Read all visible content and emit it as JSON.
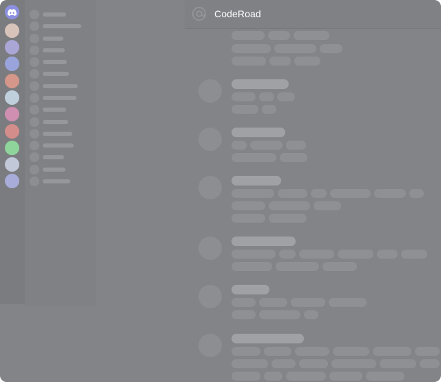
{
  "window": {
    "background": "#838488"
  },
  "header": {
    "title": "CodeRoad",
    "icon": "at-icon"
  },
  "server_rail": {
    "home_icon": "discord-logo-icon",
    "home_color": "#8c90e0",
    "servers": [
      {
        "name": "server-1",
        "color": "#d8c3bb"
      },
      {
        "name": "server-2",
        "color": "#aaa6d6"
      },
      {
        "name": "server-3",
        "color": "#9aa4dc"
      },
      {
        "name": "server-4",
        "color": "#d4978a"
      },
      {
        "name": "server-5",
        "color": "#bfd0dc"
      },
      {
        "name": "server-6",
        "color": "#cf8fb1"
      },
      {
        "name": "server-7",
        "color": "#d38d8a"
      },
      {
        "name": "server-8",
        "color": "#8fd49b"
      },
      {
        "name": "server-9",
        "color": "#c1c8d8"
      },
      {
        "name": "server-10",
        "color": "#a7acd9"
      }
    ]
  },
  "sidebar": {
    "dm_count": 15
  },
  "messages": {
    "count": 7
  }
}
